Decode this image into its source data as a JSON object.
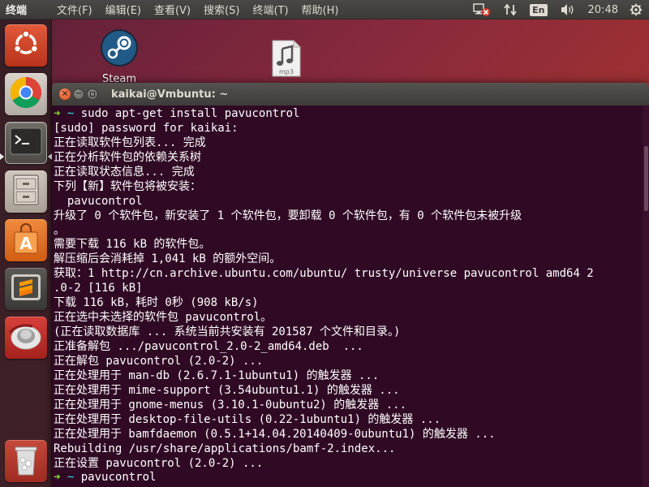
{
  "top_panel": {
    "app_name": "终端",
    "menu": [
      "文件(F)",
      "编辑(E)",
      "查看(V)",
      "搜索(S)",
      "终端(T)",
      "帮助(H)"
    ],
    "lang": "En",
    "clock": "20:48"
  },
  "launcher": {
    "items": [
      {
        "name": "ubuntu-dash",
        "icon": "ubuntu-logo-icon"
      },
      {
        "name": "chrome",
        "icon": "chrome-icon"
      },
      {
        "name": "terminal",
        "icon": "terminal-icon",
        "active": true
      },
      {
        "name": "files",
        "icon": "file-cabinet-icon"
      },
      {
        "name": "software-center",
        "icon": "shopping-bag-icon"
      },
      {
        "name": "sublime-text",
        "icon": "sublime-icon"
      },
      {
        "name": "unknown-app",
        "icon": "red-ring-icon"
      },
      {
        "name": "trash",
        "icon": "trash-icon"
      }
    ]
  },
  "desktop": {
    "icons": [
      {
        "label": "Steam",
        "icon": "steam-icon"
      },
      {
        "label": "mp3",
        "icon": "music-file-icon"
      }
    ]
  },
  "terminal": {
    "window_title": "kaikai@Vmbuntu: ~",
    "prompt_arrow": "➜",
    "prompt_dir": "~",
    "command_1": "sudo apt-get install pavucontrol",
    "command_2": "pavucontrol",
    "lines": [
      "[sudo] password for kaikai:",
      "正在读取软件包列表... 完成",
      "正在分析软件包的依赖关系树",
      "正在读取状态信息... 完成",
      "下列【新】软件包将被安装：",
      "  pavucontrol",
      "升级了 0 个软件包，新安装了 1 个软件包，要卸载 0 个软件包，有 0 个软件包未被升级",
      "。",
      "需要下载 116 kB 的软件包。",
      "解压缩后会消耗掉 1,041 kB 的额外空间。",
      "获取：1 http://cn.archive.ubuntu.com/ubuntu/ trusty/universe pavucontrol amd64 2",
      ".0-2 [116 kB]",
      "下载 116 kB，耗时 0秒 (908 kB/s)",
      "正在选中未选择的软件包 pavucontrol。",
      "(正在读取数据库 ... 系统当前共安装有 201587 个文件和目录。)",
      "正准备解包 .../pavucontrol_2.0-2_amd64.deb  ...",
      "正在解包 pavucontrol (2.0-2) ...",
      "正在处理用于 man-db (2.6.7.1-1ubuntu1) 的触发器 ...",
      "正在处理用于 mime-support (3.54ubuntu1.1) 的触发器 ...",
      "正在处理用于 gnome-menus (3.10.1-0ubuntu2) 的触发器 ...",
      "正在处理用于 desktop-file-utils (0.22-1ubuntu1) 的触发器 ...",
      "正在处理用于 bamfdaemon (0.5.1+14.04.20140409-0ubuntu1) 的触发器 ...",
      "Rebuilding /usr/share/applications/bamf-2.index...",
      "正在设置 pavucontrol (2.0-2) ..."
    ]
  },
  "colors": {
    "terminal_bg": "#300a24",
    "prompt_arrow": "#8ae234",
    "prompt_dir": "#34e2e2",
    "close_button": "#df4a16"
  }
}
